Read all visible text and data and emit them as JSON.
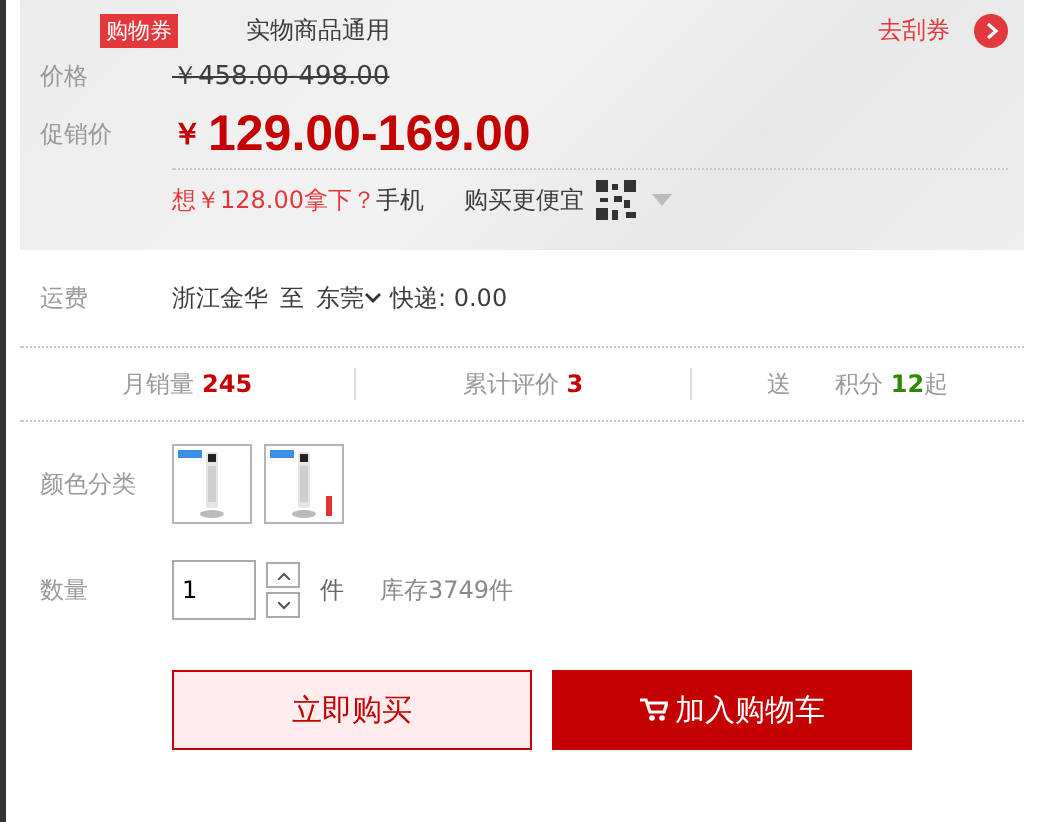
{
  "coupon": {
    "badge": "购物券",
    "text": "实物商品通用",
    "link": "去刮券"
  },
  "price": {
    "label": "价格",
    "value": "￥458.00-498.00"
  },
  "promo": {
    "label": "促销价",
    "currency": "￥",
    "value": "129.00-169.00"
  },
  "mobile": {
    "offer": "想￥128.00拿下？",
    "text_start": "手机",
    "text_end": "购买更便宜"
  },
  "shipping": {
    "label": "运费",
    "from": "浙江金华",
    "to_word": "至",
    "to": "东莞",
    "method": "快递: 0.00"
  },
  "stats": [
    {
      "label": "月销量",
      "value": "245",
      "color": "#c40000"
    },
    {
      "label": "累计评价",
      "value": "3",
      "color": "#c40000"
    },
    {
      "label": "送",
      "label_end": "积分",
      "value": "12",
      "suffix": "起",
      "color": "#2a8a00"
    }
  ],
  "color_options": {
    "label": "颜色分类"
  },
  "quantity": {
    "label": "数量",
    "value": "1",
    "unit": "件",
    "stock": "库存3749件"
  },
  "buttons": [
    {
      "label": "立即购买",
      "kind": "buy"
    },
    {
      "label": "加入购物车",
      "kind": "cart"
    }
  ]
}
